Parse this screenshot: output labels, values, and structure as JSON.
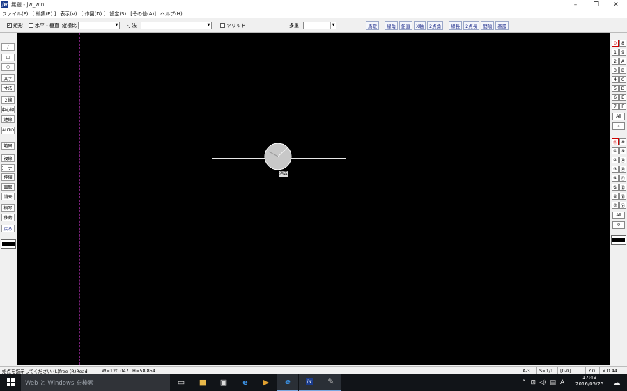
{
  "window": {
    "title": "無題 - jw_win",
    "app_icon_text": "jw",
    "controls": {
      "minimize": "–",
      "maximize": "❐",
      "close": "✕"
    }
  },
  "menu": [
    "ファイル(F)",
    "[ 編集(E) ]",
    "表示(V)",
    "[ 作図(D) ]",
    "設定(S)",
    "[その他(A)]",
    "ヘルプ(H)"
  ],
  "toolbar": {
    "rect_label": "矩形",
    "rect_checked": "✓",
    "hv_label": "水平・垂直",
    "ratio_label": "縦横比",
    "dim_label": "寸法",
    "solid_label": "ソリッド",
    "multi_label": "多重",
    "buttons": [
      "馬取",
      "線角",
      "鉛直",
      "X軸",
      "2点角",
      "線長",
      "2点長",
      "間隔",
      "基設"
    ]
  },
  "left_tools": [
    "/",
    "□",
    "○",
    "文字",
    "寸法",
    "２線",
    "中心線",
    "連線",
    "AUTO",
    "範囲",
    "複線",
    "コーナー",
    "伸縮",
    "面取",
    "消去",
    "複写",
    "移動",
    "戻る"
  ],
  "right_layers": {
    "top_left": [
      "0",
      "1",
      "2",
      "3",
      "4",
      "5",
      "6",
      "7"
    ],
    "top_right": [
      "8",
      "9",
      "A",
      "B",
      "C",
      "D",
      "E",
      "F"
    ],
    "all_label": "All",
    "x_label": "✕",
    "bottom_left": [
      "⓪",
      "①",
      "②",
      "③",
      "④",
      "⑤",
      "⑥",
      "⑦"
    ],
    "bottom_right": [
      "⑧",
      "⑨",
      "Ⓐ",
      "Ⓑ",
      "Ⓒ",
      "Ⓓ",
      "Ⓔ",
      "Ⓕ"
    ],
    "all2_label": "All",
    "zero_label": "0"
  },
  "canvas": {
    "cursor_label": "消去"
  },
  "status": {
    "message": "始点を指示してください (L)free (R)Read",
    "w_value": "W=120.047",
    "h_value": "H=58.854",
    "paper": "A-3",
    "scale": "S=1/1",
    "layer": "[0-0]",
    "angle": "∠0",
    "zoom": "× 0.44"
  },
  "taskbar": {
    "search_placeholder": "Web と Windows を検索",
    "time": "17:49",
    "date": "2016/05/25",
    "ime": "A"
  }
}
